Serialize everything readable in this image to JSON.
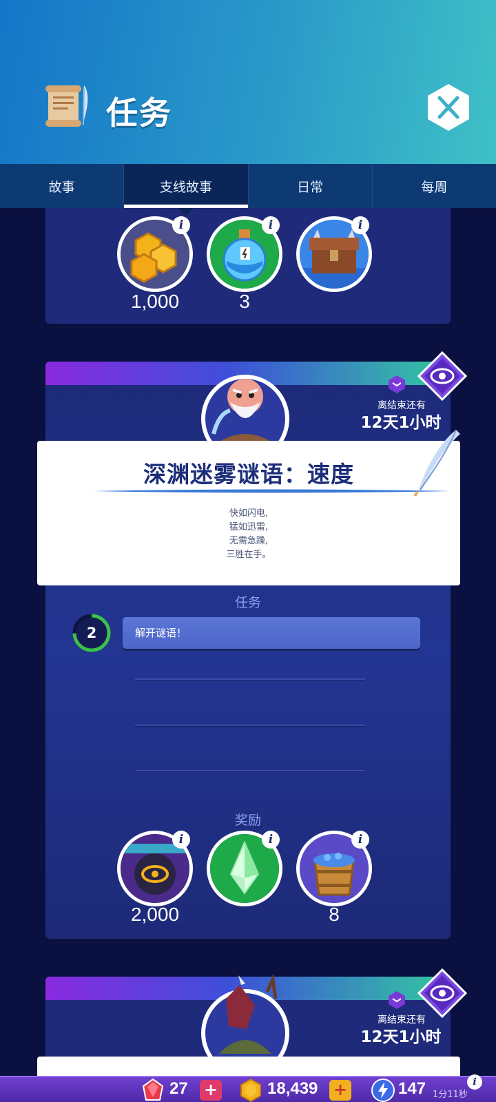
{
  "header": {
    "title": "任务"
  },
  "tabs": [
    {
      "label": "故事",
      "active": false
    },
    {
      "label": "支线故事",
      "active": true
    },
    {
      "label": "日常",
      "active": false
    },
    {
      "label": "每周",
      "active": false
    }
  ],
  "top_rewards": {
    "items": [
      {
        "icon": "gold-coins-icon",
        "amount": "1,000"
      },
      {
        "icon": "potion-icon",
        "amount": "3"
      },
      {
        "icon": "chest-icon",
        "amount": ""
      }
    ]
  },
  "quest": {
    "timer_label": "离结束还有",
    "timer_value": "12天1小时",
    "title": "深渊迷雾谜语：速度",
    "poem": [
      "快如闪电,",
      "猛如迅雷,",
      "无需急躁,",
      "三胜在手。"
    ],
    "tasks_label": "任务",
    "progress": "2",
    "task_text": "解开谜语！",
    "rewards_label": "奖励",
    "rewards": [
      {
        "icon": "eye-token-icon",
        "amount": "2,000"
      },
      {
        "icon": "green-crystal-icon",
        "amount": ""
      },
      {
        "icon": "gem-bucket-icon",
        "amount": "8"
      }
    ]
  },
  "next_quest": {
    "timer_label": "离结束还有",
    "timer_value": "12天1小时"
  },
  "currency_bar": {
    "gems": "27",
    "gold": "18,439",
    "energy": "147",
    "energy_timer": "1分11秒"
  },
  "colors": {
    "header_start": "#1575c8",
    "header_end": "#3fc1c6",
    "card_bg": "#1f2b7a",
    "page_bg": "#0a1140",
    "task_bar": "#5b76d6",
    "progress_green": "#3cc24a"
  }
}
